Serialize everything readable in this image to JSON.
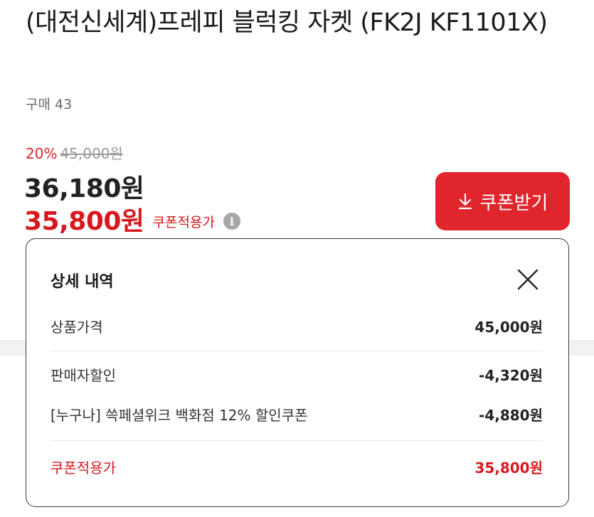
{
  "product": {
    "title": "(대전신세계)프레피 블럭킹 자켓 (FK2J KF1101X)",
    "purchase_count": "구매 43"
  },
  "price": {
    "discount_percent": "20%",
    "original_price": "45,000원",
    "sale_price": "36,180원",
    "coupon_price": "35,800원",
    "coupon_label": "쿠폰적용가",
    "info_icon": "i"
  },
  "coupon_button": {
    "label": "쿠폰받기",
    "icon": "download-arrow-icon"
  },
  "detail": {
    "title": "상세 내역",
    "close_icon": "close-icon",
    "rows": [
      {
        "label": "상품가격",
        "amount": "45,000원"
      },
      {
        "label": "판매자할인",
        "amount": "-4,320원"
      },
      {
        "label": "[누구나] 쓱페셜위크 백화점 12% 할인쿠폰",
        "amount": "-4,880원"
      },
      {
        "label": "쿠폰적용가",
        "amount": "35,800원"
      }
    ]
  },
  "colors": {
    "accent_red": "#e0262c",
    "text_dark": "#1a1a1a",
    "text_gray": "#6b6b6b"
  }
}
